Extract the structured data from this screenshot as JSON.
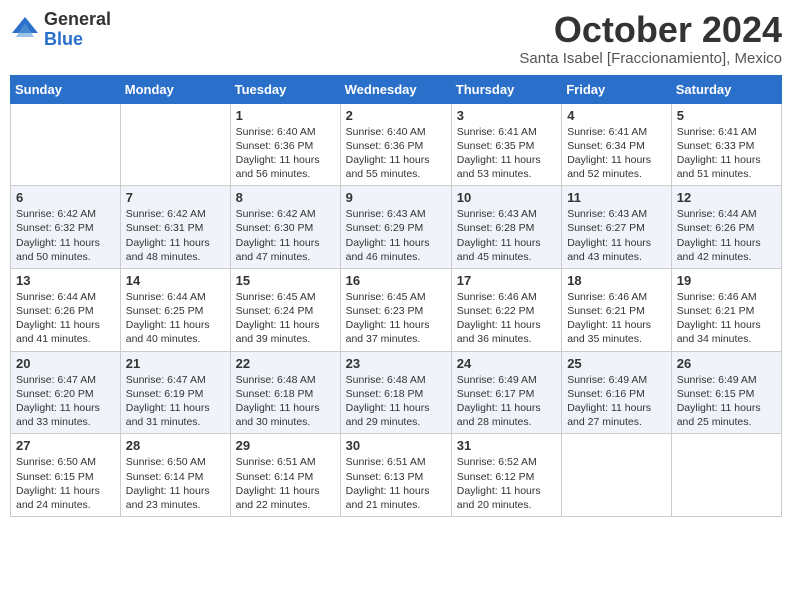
{
  "header": {
    "logo": {
      "general": "General",
      "blue": "Blue"
    },
    "title": "October 2024",
    "location": "Santa Isabel [Fraccionamiento], Mexico"
  },
  "days_of_week": [
    "Sunday",
    "Monday",
    "Tuesday",
    "Wednesday",
    "Thursday",
    "Friday",
    "Saturday"
  ],
  "weeks": [
    [
      {
        "day": "",
        "info": ""
      },
      {
        "day": "",
        "info": ""
      },
      {
        "day": "1",
        "info": "Sunrise: 6:40 AM\nSunset: 6:36 PM\nDaylight: 11 hours and 56 minutes."
      },
      {
        "day": "2",
        "info": "Sunrise: 6:40 AM\nSunset: 6:36 PM\nDaylight: 11 hours and 55 minutes."
      },
      {
        "day": "3",
        "info": "Sunrise: 6:41 AM\nSunset: 6:35 PM\nDaylight: 11 hours and 53 minutes."
      },
      {
        "day": "4",
        "info": "Sunrise: 6:41 AM\nSunset: 6:34 PM\nDaylight: 11 hours and 52 minutes."
      },
      {
        "day": "5",
        "info": "Sunrise: 6:41 AM\nSunset: 6:33 PM\nDaylight: 11 hours and 51 minutes."
      }
    ],
    [
      {
        "day": "6",
        "info": "Sunrise: 6:42 AM\nSunset: 6:32 PM\nDaylight: 11 hours and 50 minutes."
      },
      {
        "day": "7",
        "info": "Sunrise: 6:42 AM\nSunset: 6:31 PM\nDaylight: 11 hours and 48 minutes."
      },
      {
        "day": "8",
        "info": "Sunrise: 6:42 AM\nSunset: 6:30 PM\nDaylight: 11 hours and 47 minutes."
      },
      {
        "day": "9",
        "info": "Sunrise: 6:43 AM\nSunset: 6:29 PM\nDaylight: 11 hours and 46 minutes."
      },
      {
        "day": "10",
        "info": "Sunrise: 6:43 AM\nSunset: 6:28 PM\nDaylight: 11 hours and 45 minutes."
      },
      {
        "day": "11",
        "info": "Sunrise: 6:43 AM\nSunset: 6:27 PM\nDaylight: 11 hours and 43 minutes."
      },
      {
        "day": "12",
        "info": "Sunrise: 6:44 AM\nSunset: 6:26 PM\nDaylight: 11 hours and 42 minutes."
      }
    ],
    [
      {
        "day": "13",
        "info": "Sunrise: 6:44 AM\nSunset: 6:26 PM\nDaylight: 11 hours and 41 minutes."
      },
      {
        "day": "14",
        "info": "Sunrise: 6:44 AM\nSunset: 6:25 PM\nDaylight: 11 hours and 40 minutes."
      },
      {
        "day": "15",
        "info": "Sunrise: 6:45 AM\nSunset: 6:24 PM\nDaylight: 11 hours and 39 minutes."
      },
      {
        "day": "16",
        "info": "Sunrise: 6:45 AM\nSunset: 6:23 PM\nDaylight: 11 hours and 37 minutes."
      },
      {
        "day": "17",
        "info": "Sunrise: 6:46 AM\nSunset: 6:22 PM\nDaylight: 11 hours and 36 minutes."
      },
      {
        "day": "18",
        "info": "Sunrise: 6:46 AM\nSunset: 6:21 PM\nDaylight: 11 hours and 35 minutes."
      },
      {
        "day": "19",
        "info": "Sunrise: 6:46 AM\nSunset: 6:21 PM\nDaylight: 11 hours and 34 minutes."
      }
    ],
    [
      {
        "day": "20",
        "info": "Sunrise: 6:47 AM\nSunset: 6:20 PM\nDaylight: 11 hours and 33 minutes."
      },
      {
        "day": "21",
        "info": "Sunrise: 6:47 AM\nSunset: 6:19 PM\nDaylight: 11 hours and 31 minutes."
      },
      {
        "day": "22",
        "info": "Sunrise: 6:48 AM\nSunset: 6:18 PM\nDaylight: 11 hours and 30 minutes."
      },
      {
        "day": "23",
        "info": "Sunrise: 6:48 AM\nSunset: 6:18 PM\nDaylight: 11 hours and 29 minutes."
      },
      {
        "day": "24",
        "info": "Sunrise: 6:49 AM\nSunset: 6:17 PM\nDaylight: 11 hours and 28 minutes."
      },
      {
        "day": "25",
        "info": "Sunrise: 6:49 AM\nSunset: 6:16 PM\nDaylight: 11 hours and 27 minutes."
      },
      {
        "day": "26",
        "info": "Sunrise: 6:49 AM\nSunset: 6:15 PM\nDaylight: 11 hours and 25 minutes."
      }
    ],
    [
      {
        "day": "27",
        "info": "Sunrise: 6:50 AM\nSunset: 6:15 PM\nDaylight: 11 hours and 24 minutes."
      },
      {
        "day": "28",
        "info": "Sunrise: 6:50 AM\nSunset: 6:14 PM\nDaylight: 11 hours and 23 minutes."
      },
      {
        "day": "29",
        "info": "Sunrise: 6:51 AM\nSunset: 6:14 PM\nDaylight: 11 hours and 22 minutes."
      },
      {
        "day": "30",
        "info": "Sunrise: 6:51 AM\nSunset: 6:13 PM\nDaylight: 11 hours and 21 minutes."
      },
      {
        "day": "31",
        "info": "Sunrise: 6:52 AM\nSunset: 6:12 PM\nDaylight: 11 hours and 20 minutes."
      },
      {
        "day": "",
        "info": ""
      },
      {
        "day": "",
        "info": ""
      }
    ]
  ]
}
